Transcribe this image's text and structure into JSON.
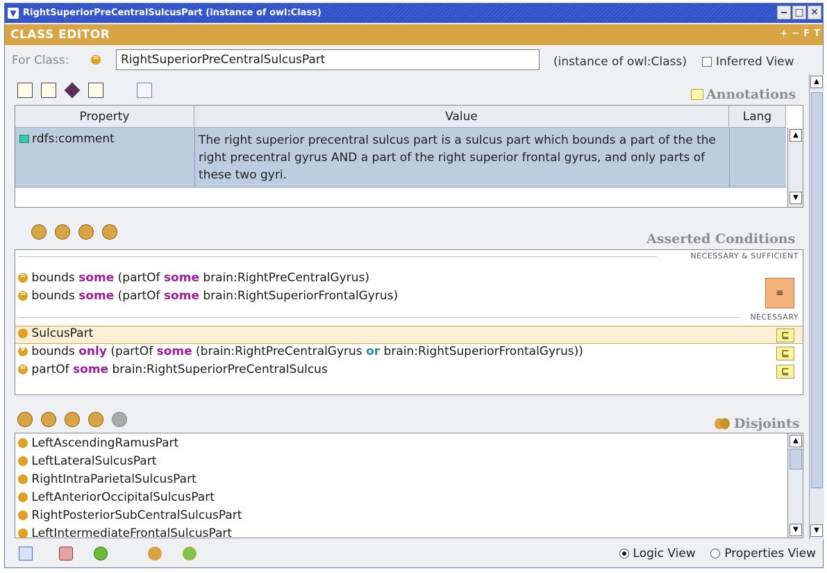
{
  "window": {
    "title": "RightSuperiorPreCentralSulcusPart   (instance of owl:Class)",
    "buttons": [
      "minimize-icon",
      "maximize-icon",
      "close-icon"
    ]
  },
  "editor": {
    "header": "CLASS EDITOR",
    "header_tools": [
      "+",
      "−",
      "F",
      "T"
    ]
  },
  "for_class": {
    "label": "For Class:",
    "value": "RightSuperiorPreCentralSulcusPart",
    "instance_of": "(instance of owl:Class)",
    "inferred_view_label": "Inferred View",
    "inferred_view_checked": false
  },
  "annotations": {
    "title": "Annotations",
    "columns": [
      "Property",
      "Value",
      "Lang"
    ],
    "rows": [
      {
        "property": "rdfs:comment",
        "value": "The right superior precentral sulcus part is a sulcus part which bounds a part of the the right precentral gyrus AND a part of the right superior frontal gyrus, and only parts of these two gyri.",
        "lang": ""
      }
    ]
  },
  "conditions": {
    "title": "Asserted Conditions",
    "group_necessary_sufficient": "NECESSARY & SUFFICIENT",
    "group_necessary": "NECESSARY",
    "ns": [
      {
        "p1": "bounds",
        "k1": "some",
        "p2": "(partOf",
        "k2": "some",
        "p3": "brain:RightPreCentralGyrus)"
      },
      {
        "p1": "bounds",
        "k1": "some",
        "p2": "(partOf",
        "k2": "some",
        "p3": "brain:RightSuperiorFrontalGyrus)"
      }
    ],
    "equiv_symbol": "≡",
    "subclass_symbol": "⊑",
    "necessary": {
      "selected": "SulcusPart",
      "row2": {
        "p1": "bounds",
        "k1": "only",
        "p2": "(partOf",
        "k2": "some",
        "p3": "(brain:RightPreCentralGyrus",
        "k3": "or",
        "p4": "brain:RightSuperiorFrontalGyrus))"
      },
      "row3": {
        "p1": "partOf",
        "k1": "some",
        "p2": "brain:RightSuperiorPreCentralSulcus"
      }
    }
  },
  "disjoints": {
    "title": "Disjoints",
    "items": [
      "LeftAscendingRamusPart",
      "LeftLateralSulcusPart",
      "RightIntraParietalSulcusPart",
      "LeftAnteriorOccipitalSulcusPart",
      "RightPosteriorSubCentralSulcusPart",
      "LeftIntermediateFrontalSulcusPart"
    ]
  },
  "bottom": {
    "logic_view": "Logic View",
    "properties_view": "Properties View",
    "selected_view": "Logic View"
  },
  "colors": {
    "accent": "#d9a544",
    "titlebar": "#3b5ed6",
    "selection": "#bdcde0",
    "keyword": "#9a1f9a"
  }
}
